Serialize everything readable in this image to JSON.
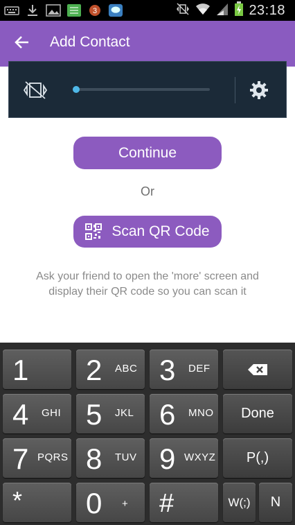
{
  "status_bar": {
    "time": "23:18",
    "notification_badge": "3",
    "icons": [
      "keyboard-icon",
      "download-icon",
      "image-icon",
      "app-icon",
      "notification-badge-icon",
      "messenger-icon",
      "silent-mode-icon",
      "wifi-icon",
      "signal-icon",
      "battery-charging-icon"
    ]
  },
  "app_bar": {
    "title": "Add Contact",
    "back_icon": "arrow-left-icon",
    "color": "#8a5bc0"
  },
  "volume_panel": {
    "mute_icon": "vibrate-mute-icon",
    "level": 0,
    "settings_icon": "gear-icon"
  },
  "main": {
    "continue_label": "Continue",
    "or_label": "Or",
    "scan_label": "Scan QR Code",
    "scan_icon": "qr-code-icon",
    "hint": "Ask your friend to open the 'more' screen and display their QR code so you can scan it"
  },
  "keypad": {
    "keys": [
      {
        "num": "1",
        "letters": ""
      },
      {
        "num": "2",
        "letters": "ABC"
      },
      {
        "num": "3",
        "letters": "DEF"
      },
      {
        "label": "backspace-icon"
      },
      {
        "num": "4",
        "letters": "GHI"
      },
      {
        "num": "5",
        "letters": "JKL"
      },
      {
        "num": "6",
        "letters": "MNO"
      },
      {
        "label": "Done"
      },
      {
        "num": "7",
        "letters": "PQRS"
      },
      {
        "num": "8",
        "letters": "TUV"
      },
      {
        "num": "9",
        "letters": "WXYZ"
      },
      {
        "label": "P(,)"
      },
      {
        "num": "*",
        "letters": ""
      },
      {
        "num": "0",
        "letters": "+"
      },
      {
        "num": "#",
        "letters": ""
      },
      {
        "label": "W(;)"
      },
      {
        "label": "N"
      }
    ]
  }
}
